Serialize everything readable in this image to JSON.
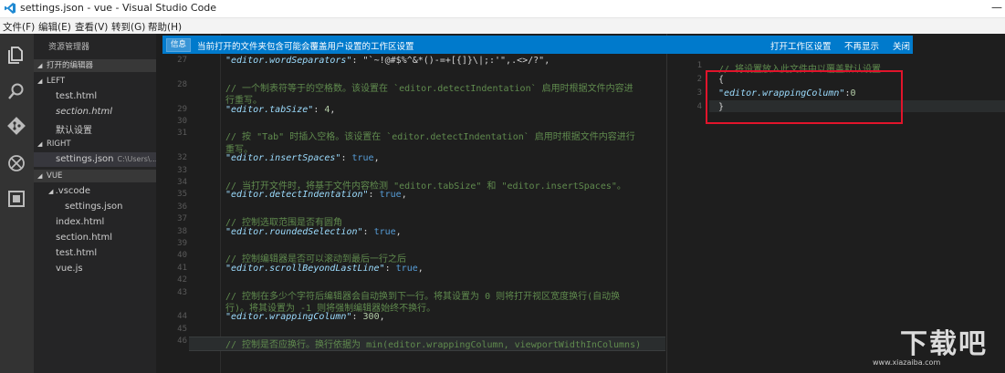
{
  "window": {
    "title": "settings.json - vue - Visual Studio Code"
  },
  "menu": [
    "文件(F)",
    "编辑(E)",
    "查看(V)",
    "转到(G)",
    "帮助(H)"
  ],
  "sidebar": {
    "header": "资源管理器",
    "open_editors_label": "打开的编辑器",
    "left_label": "LEFT",
    "left_items": [
      "test.html",
      "section.html",
      "默认设置"
    ],
    "right_label": "RIGHT",
    "right_item": "settings.json",
    "right_item_path": "C:\\Users\\...",
    "vue_label": "VUE",
    "vscode_folder": ".vscode",
    "vue_items": [
      "settings.json",
      "index.html",
      "section.html",
      "test.html",
      "vue.js"
    ]
  },
  "notification": {
    "badge": "信息",
    "message": "当前打开的文件夹包含可能会覆盖用户设置的工作区设置",
    "open_workspace": "打开工作区设置",
    "dont_show": "不再显示",
    "close": "关闭"
  },
  "left_editor": {
    "lines": [
      {
        "n": "27",
        "parts": [
          {
            "t": "\"editor.wordSeparators\"",
            "c": "key"
          },
          {
            "t": ": \"`~!@#$%^&*()-=+[{]}\\|;:'\",.<>/?\",",
            "c": "pun"
          }
        ]
      },
      {
        "n": "",
        "parts": []
      },
      {
        "n": "28",
        "parts": [
          {
            "t": "// 一个制表符等于的空格数。该设置在 `editor.detectIndentation` 启用时根据文件内容进",
            "c": "cmt"
          }
        ]
      },
      {
        "n": "",
        "parts": [
          {
            "t": "行重写。",
            "c": "cmt"
          }
        ]
      },
      {
        "n": "29",
        "parts": [
          {
            "t": "\"editor.tabSize\"",
            "c": "key"
          },
          {
            "t": ": ",
            "c": "pun"
          },
          {
            "t": "4",
            "c": "num"
          },
          {
            "t": ",",
            "c": "pun"
          }
        ]
      },
      {
        "n": "30",
        "parts": []
      },
      {
        "n": "31",
        "parts": [
          {
            "t": "// 按 \"Tab\" 时插入空格。该设置在 `editor.detectIndentation` 启用时根据文件内容进行",
            "c": "cmt"
          }
        ]
      },
      {
        "n": "",
        "parts": [
          {
            "t": "重写。",
            "c": "cmt"
          }
        ]
      },
      {
        "n": "32",
        "parts": [
          {
            "t": "\"editor.insertSpaces\"",
            "c": "key"
          },
          {
            "t": ": ",
            "c": "pun"
          },
          {
            "t": "true",
            "c": "kw"
          },
          {
            "t": ",",
            "c": "pun"
          }
        ]
      },
      {
        "n": "33",
        "parts": []
      },
      {
        "n": "34",
        "parts": [
          {
            "t": "// 当打开文件时，将基于文件内容检测 \"editor.tabSize\" 和 \"editor.insertSpaces\"。",
            "c": "cmt"
          }
        ]
      },
      {
        "n": "35",
        "parts": [
          {
            "t": "\"editor.detectIndentation\"",
            "c": "key"
          },
          {
            "t": ": ",
            "c": "pun"
          },
          {
            "t": "true",
            "c": "kw"
          },
          {
            "t": ",",
            "c": "pun"
          }
        ]
      },
      {
        "n": "36",
        "parts": []
      },
      {
        "n": "37",
        "parts": [
          {
            "t": "// 控制选取范围是否有圆角",
            "c": "cmt"
          }
        ]
      },
      {
        "n": "38",
        "parts": [
          {
            "t": "\"editor.roundedSelection\"",
            "c": "key"
          },
          {
            "t": ": ",
            "c": "pun"
          },
          {
            "t": "true",
            "c": "kw"
          },
          {
            "t": ",",
            "c": "pun"
          }
        ]
      },
      {
        "n": "39",
        "parts": []
      },
      {
        "n": "40",
        "parts": [
          {
            "t": "// 控制编辑器是否可以滚动到最后一行之后",
            "c": "cmt"
          }
        ]
      },
      {
        "n": "41",
        "parts": [
          {
            "t": "\"editor.scrollBeyondLastLine\"",
            "c": "key"
          },
          {
            "t": ": ",
            "c": "pun"
          },
          {
            "t": "true",
            "c": "kw"
          },
          {
            "t": ",",
            "c": "pun"
          }
        ]
      },
      {
        "n": "42",
        "parts": []
      },
      {
        "n": "43",
        "parts": [
          {
            "t": "// 控制在多少个字符后编辑器会自动换到下一行。将其设置为 0 则将打开视区宽度换行(自动换",
            "c": "cmt"
          }
        ]
      },
      {
        "n": "",
        "parts": [
          {
            "t": "行)。将其设置为 -1 则将强制编辑器始终不换行。",
            "c": "cmt"
          }
        ]
      },
      {
        "n": "44",
        "parts": [
          {
            "t": "\"editor.wrappingColumn\"",
            "c": "key"
          },
          {
            "t": ": ",
            "c": "pun"
          },
          {
            "t": "300",
            "c": "num"
          },
          {
            "t": ",",
            "c": "pun"
          }
        ]
      },
      {
        "n": "45",
        "parts": []
      },
      {
        "n": "46",
        "parts": [
          {
            "t": "// 控制是否应换行。换行依据为 min(editor.wrappingColumn, viewportWidthInColumns)",
            "c": "cmt"
          }
        ]
      }
    ]
  },
  "right_editor": {
    "lines": [
      {
        "n": "1",
        "parts": [
          {
            "t": "// 将设置放入此文件中以覆盖默认设置",
            "c": "cmt"
          }
        ]
      },
      {
        "n": "2",
        "parts": [
          {
            "t": "{",
            "c": "pun"
          }
        ]
      },
      {
        "n": "3",
        "parts": [
          {
            "t": "    \"editor.wrappingColumn\"",
            "c": "key"
          },
          {
            "t": ":",
            "c": "pun"
          },
          {
            "t": "0",
            "c": "num"
          }
        ]
      },
      {
        "n": "4",
        "parts": [
          {
            "t": "}",
            "c": "pun"
          }
        ]
      }
    ]
  },
  "watermark": {
    "cn": "下载吧",
    "en": "www.xiazaiba.com"
  },
  "colors": {
    "accent": "#007acc",
    "highlight_box": "#e1142b"
  }
}
